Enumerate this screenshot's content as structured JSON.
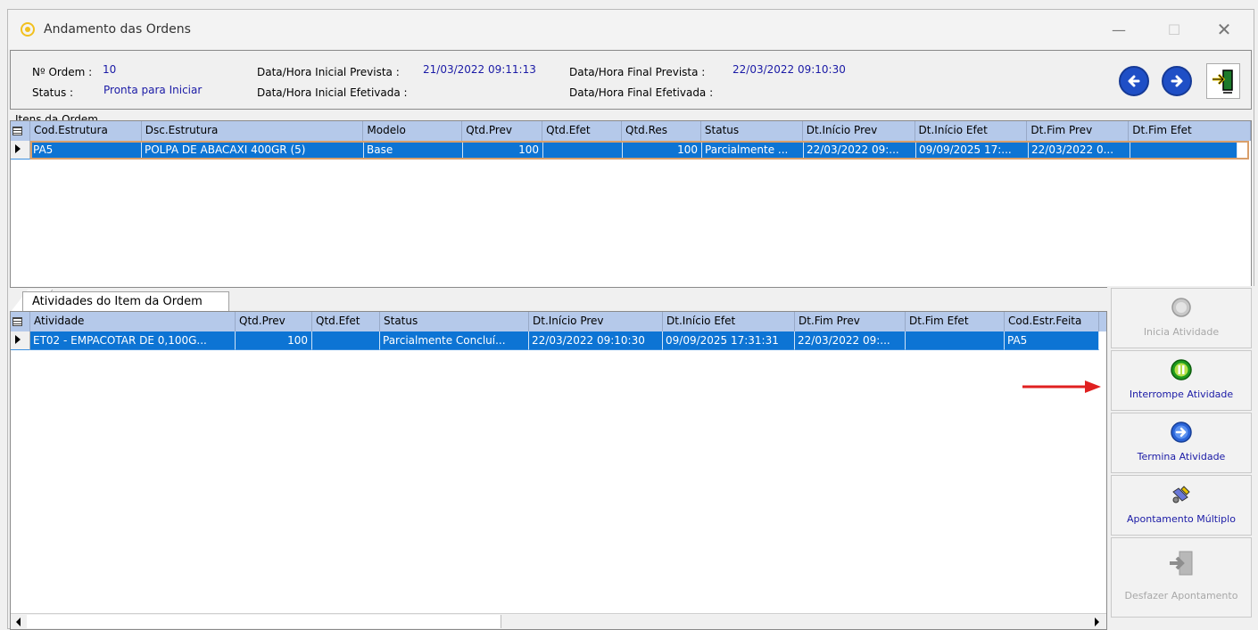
{
  "window": {
    "title": "Andamento das Ordens"
  },
  "header": {
    "ordem_label": "Nº Ordem :",
    "ordem_value": "10",
    "status_label": "Status :",
    "status_value": "Pronta para Iniciar",
    "ini_prev_label": "Data/Hora Inicial Prevista :",
    "ini_prev_value": "21/03/2022 09:11:13",
    "ini_efet_label": "Data/Hora Inicial Efetivada :",
    "fim_prev_label": "Data/Hora Final Prevista :",
    "fim_prev_value": "22/03/2022 09:10:30",
    "fim_efet_label": "Data/Hora Final Efetivada :"
  },
  "itens": {
    "legend": "Itens da Ordem",
    "columns": [
      "Cod.Estrutura",
      "Dsc.Estrutura",
      "Modelo",
      "Qtd.Prev",
      "Qtd.Efet",
      "Qtd.Res",
      "Status",
      "Dt.Início Prev",
      "Dt.Início Efet",
      "Dt.Fim Prev",
      "Dt.Fim Efet"
    ],
    "row": [
      "PA5",
      "POLPA DE ABACAXI 400GR  (5)",
      "Base",
      "100",
      "",
      "100",
      "Parcialmente ...",
      "22/03/2022 09:...",
      "09/09/2025 17:...",
      "22/03/2022 0...",
      ""
    ]
  },
  "atividades": {
    "tab_label": "Atividades do Item da Ordem",
    "columns": [
      "Atividade",
      "Qtd.Prev",
      "Qtd.Efet",
      "Status",
      "Dt.Início Prev",
      "Dt.Início Efet",
      "Dt.Fim Prev",
      "Dt.Fim Efet",
      "Cod.Estr.Feita"
    ],
    "row": [
      "ET02 - EMPACOTAR DE 0,100G...",
      "100",
      "",
      "Parcialmente Concluí...",
      "22/03/2022 09:10:30",
      "09/09/2025 17:31:31",
      "22/03/2022 09:...",
      "",
      "PA5"
    ]
  },
  "side_buttons": [
    {
      "label": "Inicia Atividade",
      "icon": "play-icon",
      "enabled": false
    },
    {
      "label": "Interrompe Atividade",
      "icon": "pause-icon",
      "enabled": true
    },
    {
      "label": "Termina Atividade",
      "icon": "arrow-right-circle-icon",
      "enabled": true
    },
    {
      "label": "Apontamento Múltiplo",
      "icon": "brush-icon",
      "enabled": true
    },
    {
      "label": "Desfazer Apontamento",
      "icon": "undo-doc-icon",
      "enabled": false
    }
  ],
  "colors": {
    "selection": "#0d74d4",
    "header": "#b5c9ea",
    "value_text": "#1a1aa6",
    "annotation_arrow": "#e02020"
  }
}
